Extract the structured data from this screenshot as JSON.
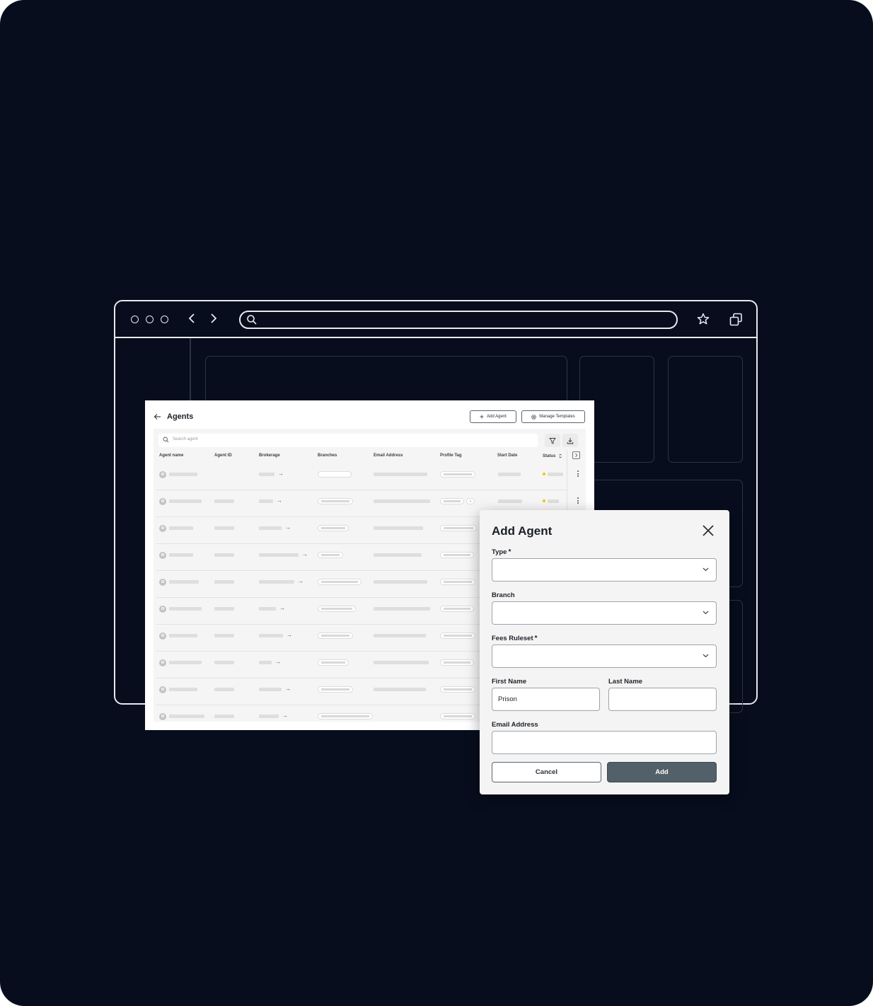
{
  "browser": {
    "window_controls": [
      "circle-icon",
      "circle-icon",
      "circle-icon"
    ],
    "nav_icons": [
      "chevron-left-icon",
      "chevron-right-icon"
    ],
    "toolbar_icons": [
      "star-icon",
      "copy-icon"
    ]
  },
  "agents_page": {
    "title": "Agents",
    "add_agent_label": "Add Agent",
    "manage_templates_label": "Manage Templates",
    "search_placeholder": "Search agent",
    "columns": [
      "Agent name",
      "Agent ID",
      "Brokerage",
      "Branches",
      "Email Address",
      "Profile Tag",
      "Start Date",
      "Status"
    ],
    "row_count": 10
  },
  "add_agent_modal": {
    "title": "Add Agent",
    "type_label": "Type",
    "branch_label": "Branch",
    "fees_ruleset_label": "Fees Ruleset",
    "first_name_label": "First Name",
    "first_name_value": "Prison",
    "last_name_label": "Last Name",
    "last_name_value": "",
    "email_label": "Email Address",
    "email_value": "",
    "required_marker": "*",
    "cancel_label": "Cancel",
    "add_label": "Add"
  },
  "colors": {
    "background": "#070d1d",
    "primary_button": "#526069",
    "status_pending": "#f2c40f"
  }
}
